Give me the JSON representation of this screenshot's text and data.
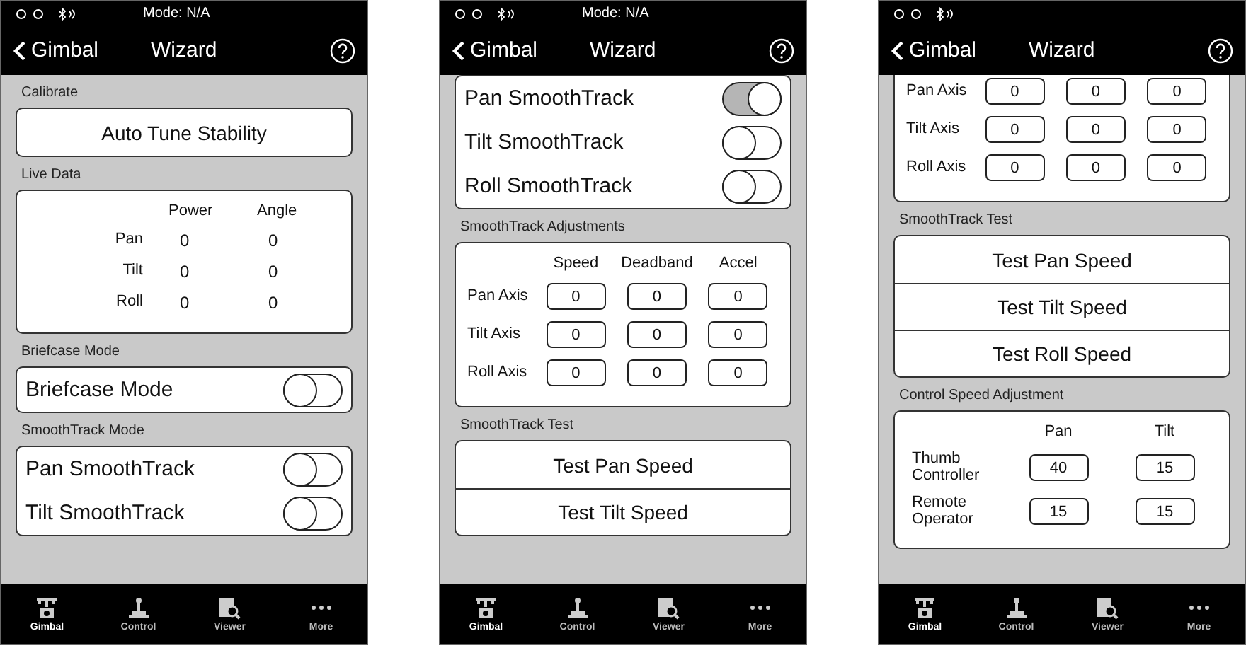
{
  "screens": [
    {
      "status": {
        "mode": "Mode: N/A"
      },
      "nav": {
        "back": "Gimbal",
        "title": "Wizard"
      },
      "sections": [
        {
          "kind": "header",
          "text": "Calibrate"
        },
        {
          "kind": "buttons",
          "buttons": [
            "Auto Tune Stability"
          ]
        },
        {
          "kind": "header",
          "text": "Live Data"
        },
        {
          "kind": "readings",
          "columns": [
            "Power",
            "Angle"
          ],
          "rows": [
            {
              "label": "Pan",
              "values": [
                "0",
                "0"
              ]
            },
            {
              "label": "Tilt",
              "values": [
                "0",
                "0"
              ]
            },
            {
              "label": "Roll",
              "values": [
                "0",
                "0"
              ]
            }
          ]
        },
        {
          "kind": "header",
          "text": "Briefcase Mode"
        },
        {
          "kind": "toggles",
          "items": [
            {
              "label": "Briefcase Mode",
              "on": false
            }
          ]
        },
        {
          "kind": "header",
          "text": "SmoothTrack Mode"
        },
        {
          "kind": "toggles",
          "items": [
            {
              "label": "Pan SmoothTrack",
              "on": false
            },
            {
              "label": "Tilt SmoothTrack",
              "on": false
            }
          ]
        }
      ],
      "tabs": [
        {
          "label": "Gimbal",
          "selected": true
        },
        {
          "label": "Control",
          "selected": false
        },
        {
          "label": "Viewer",
          "selected": false
        },
        {
          "label": "More",
          "selected": false
        }
      ]
    },
    {
      "status": {
        "mode": "Mode: N/A"
      },
      "nav": {
        "back": "Gimbal",
        "title": "Wizard"
      },
      "sections": [
        {
          "kind": "toggles",
          "items": [
            {
              "label": "Pan SmoothTrack",
              "on": true
            },
            {
              "label": "Tilt SmoothTrack",
              "on": false
            },
            {
              "label": "Roll SmoothTrack",
              "on": false
            }
          ]
        },
        {
          "kind": "header",
          "text": "SmoothTrack Adjustments"
        },
        {
          "kind": "inputs",
          "columns": [
            "Speed",
            "Deadband",
            "Accel"
          ],
          "rows": [
            {
              "label": "Pan Axis",
              "values": [
                "0",
                "0",
                "0"
              ]
            },
            {
              "label": "Tilt Axis",
              "values": [
                "0",
                "0",
                "0"
              ]
            },
            {
              "label": "Roll Axis",
              "values": [
                "0",
                "0",
                "0"
              ]
            }
          ]
        },
        {
          "kind": "header",
          "text": "SmoothTrack Test"
        },
        {
          "kind": "buttons",
          "buttons": [
            "Test Pan Speed",
            "Test Tilt Speed"
          ]
        }
      ],
      "tabs": [
        {
          "label": "Gimbal",
          "selected": true
        },
        {
          "label": "Control",
          "selected": false
        },
        {
          "label": "Viewer",
          "selected": false
        },
        {
          "label": "More",
          "selected": false
        }
      ]
    },
    {
      "nav": {
        "back": "Gimbal",
        "title": "Wizard"
      },
      "sections": [
        {
          "kind": "inputs",
          "cut_top": true,
          "rows": [
            {
              "label": "Pan Axis",
              "values": [
                "0",
                "0",
                "0"
              ]
            },
            {
              "label": "Tilt Axis",
              "values": [
                "0",
                "0",
                "0"
              ]
            },
            {
              "label": "Roll Axis",
              "values": [
                "0",
                "0",
                "0"
              ]
            }
          ]
        },
        {
          "kind": "header",
          "text": "SmoothTrack Test"
        },
        {
          "kind": "buttons",
          "buttons": [
            "Test Pan Speed",
            "Test Tilt Speed",
            "Test Roll Speed"
          ]
        },
        {
          "kind": "header",
          "text": "Control Speed Adjustment"
        },
        {
          "kind": "inputs",
          "columns": [
            "Pan",
            "Tilt"
          ],
          "rows": [
            {
              "label": "Thumb Controller",
              "values": [
                "40",
                "15"
              ]
            },
            {
              "label": "Remote Operator",
              "values": [
                "15",
                "15"
              ]
            }
          ]
        }
      ],
      "tabs": [
        {
          "label": "Gimbal",
          "selected": true
        },
        {
          "label": "Control",
          "selected": false
        },
        {
          "label": "Viewer",
          "selected": false
        },
        {
          "label": "More",
          "selected": false
        }
      ]
    }
  ]
}
